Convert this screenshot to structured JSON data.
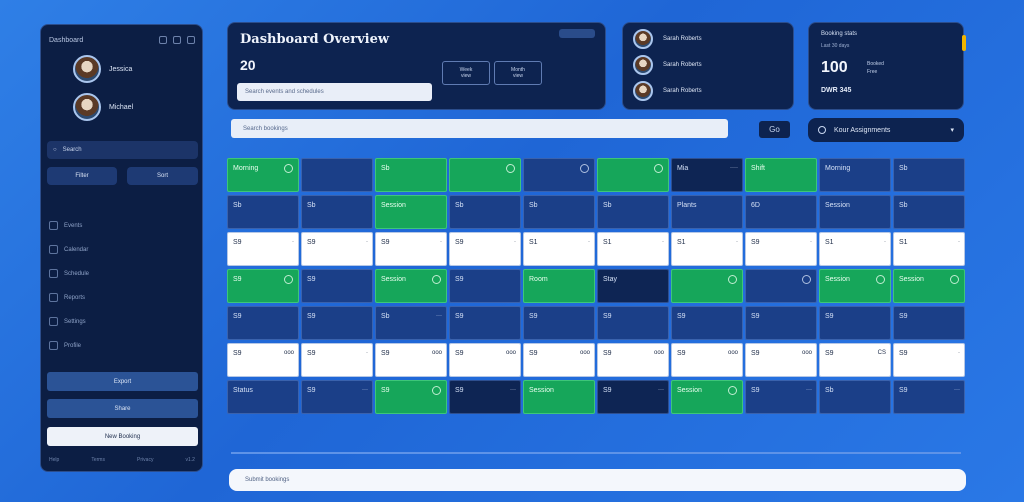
{
  "sidebar": {
    "app_title": "Dashboard",
    "profiles": [
      {
        "name": "Jessica"
      },
      {
        "name": "Michael"
      }
    ],
    "search_label": "Search",
    "buttons": [
      "Filter",
      "Sort"
    ],
    "nav": [
      "Events",
      "Calendar",
      "Schedule",
      "Reports",
      "Settings",
      "Profile"
    ],
    "actions": [
      "Export",
      "Share",
      "New Booking"
    ],
    "footer": [
      "Help",
      "Terms",
      "Privacy",
      "v1.2"
    ]
  },
  "header": {
    "title": "Dashboard Overview",
    "count": "20",
    "mini_buttons": [
      {
        "l1": "Week",
        "l2": "view"
      },
      {
        "l1": "Month",
        "l2": "view"
      }
    ],
    "input_text": "Search events and schedules"
  },
  "people": [
    "Sarah Roberts",
    "Sarah Roberts",
    "Sarah Roberts"
  ],
  "stats": {
    "heading": "Booking stats",
    "sub": "Last 30 days",
    "big": "100",
    "bars": [
      "Booked",
      "Free"
    ],
    "foot": "DWR 345"
  },
  "filter_text": "Search bookings",
  "filter_button": "Go",
  "select_label": "Kour Assignments",
  "grid": [
    [
      {
        "s": "green",
        "t": "Morning",
        "i": true
      },
      {
        "s": "blue",
        "t": ""
      },
      {
        "s": "green",
        "t": "Sb",
        "i": false
      },
      {
        "s": "green",
        "t": "",
        "i": true
      },
      {
        "s": "blue",
        "t": "",
        "i": true
      },
      {
        "s": "green",
        "t": "",
        "i": true
      },
      {
        "s": "dark",
        "t": "Mia",
        "tag": "····"
      },
      {
        "s": "green",
        "t": "Shift",
        "i": false
      },
      {
        "s": "blue",
        "t": "Morning",
        "i": false
      },
      {
        "s": "blue",
        "t": "Sb",
        "i": false
      }
    ],
    [
      {
        "s": "blue",
        "t": "Sb",
        "i": false
      },
      {
        "s": "blue",
        "t": "Sb",
        "i": false
      },
      {
        "s": "green",
        "t": "Session"
      },
      {
        "s": "blue",
        "t": "Sb",
        "i": false
      },
      {
        "s": "blue",
        "t": "Sb",
        "i": false
      },
      {
        "s": "blue",
        "t": "Sb",
        "i": false
      },
      {
        "s": "blue",
        "t": "Plants",
        "i": false
      },
      {
        "s": "blue",
        "t": "6D",
        "i": false
      },
      {
        "s": "blue",
        "t": "Session"
      },
      {
        "s": "blue",
        "t": "Sb"
      }
    ],
    [
      {
        "s": "white",
        "t": "S9",
        "tag": "·"
      },
      {
        "s": "white",
        "t": "S9",
        "tag": "·"
      },
      {
        "s": "white",
        "t": "S9",
        "tag": "·"
      },
      {
        "s": "white",
        "t": "S9",
        "tag": "·"
      },
      {
        "s": "white",
        "t": "S1",
        "tag": "·"
      },
      {
        "s": "white",
        "t": "S1",
        "tag": "·"
      },
      {
        "s": "white",
        "t": "S1",
        "tag": "·"
      },
      {
        "s": "white",
        "t": "S9",
        "tag": "·"
      },
      {
        "s": "white",
        "t": "S1",
        "tag": "·"
      },
      {
        "s": "white",
        "t": "S1",
        "tag": "·"
      }
    ],
    [
      {
        "s": "green",
        "t": "S9",
        "i": true
      },
      {
        "s": "blue",
        "t": "S9",
        "i": false
      },
      {
        "s": "green",
        "t": "Session",
        "i": true
      },
      {
        "s": "blue",
        "t": "S9",
        "i": false
      },
      {
        "s": "green",
        "t": "Room",
        "i": false
      },
      {
        "s": "dark",
        "t": "Stay"
      },
      {
        "s": "green",
        "t": "",
        "i": true
      },
      {
        "s": "blue",
        "t": "",
        "i": true
      },
      {
        "s": "green",
        "t": "Session",
        "i": true
      },
      {
        "s": "green",
        "t": "Session",
        "i": true
      }
    ],
    [
      {
        "s": "blue",
        "t": "S9",
        "i": false
      },
      {
        "s": "blue",
        "t": "S9",
        "i": false
      },
      {
        "s": "blue",
        "t": "Sb",
        "tag": "···"
      },
      {
        "s": "blue",
        "t": "S9",
        "i": false
      },
      {
        "s": "blue",
        "t": "S9",
        "i": false
      },
      {
        "s": "blue",
        "t": "S9",
        "i": false
      },
      {
        "s": "blue",
        "t": "S9",
        "i": false
      },
      {
        "s": "blue",
        "t": "S9",
        "i": false
      },
      {
        "s": "blue",
        "t": "S9",
        "i": false
      },
      {
        "s": "blue",
        "t": "S9",
        "i": false
      }
    ],
    [
      {
        "s": "white",
        "t": "S9",
        "tag": "ooo"
      },
      {
        "s": "white",
        "t": "S9",
        "tag": "·"
      },
      {
        "s": "white",
        "t": "S9",
        "tag": "ooo"
      },
      {
        "s": "white",
        "t": "S9",
        "tag": "ooo"
      },
      {
        "s": "white",
        "t": "S9",
        "tag": "ooo"
      },
      {
        "s": "white",
        "t": "S9",
        "tag": "ooo"
      },
      {
        "s": "white",
        "t": "S9",
        "tag": "ooo"
      },
      {
        "s": "white",
        "t": "S9",
        "tag": "ooo"
      },
      {
        "s": "white",
        "t": "S9",
        "tag": "CS"
      },
      {
        "s": "white",
        "t": "S9",
        "tag": "·"
      }
    ],
    [
      {
        "s": "blue",
        "t": "Status"
      },
      {
        "s": "blue",
        "t": "S9",
        "tag": "···"
      },
      {
        "s": "green",
        "t": "S9",
        "i": true
      },
      {
        "s": "dark",
        "t": "S9",
        "tag": "···"
      },
      {
        "s": "green",
        "t": "Session"
      },
      {
        "s": "dark",
        "t": "S9",
        "tag": "···"
      },
      {
        "s": "green",
        "t": "Session",
        "i": true
      },
      {
        "s": "blue",
        "t": "S9",
        "tag": "···"
      },
      {
        "s": "blue",
        "t": "Sb"
      },
      {
        "s": "blue",
        "t": "S9",
        "tag": "···"
      }
    ]
  ],
  "bottom_text": "Submit bookings"
}
